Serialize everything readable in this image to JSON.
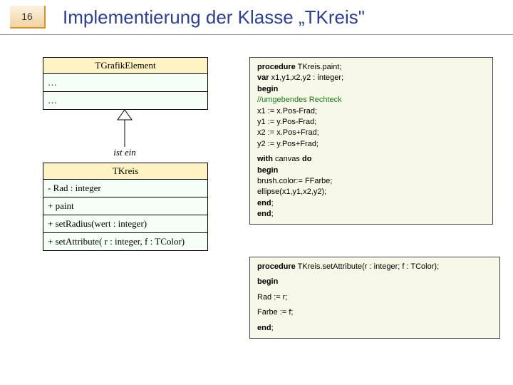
{
  "slide_number": "16",
  "title": "Implementierung der Klasse „TKreis\"",
  "uml": {
    "parent": {
      "name": "TGrafikElement",
      "row1": "…",
      "row2": "…"
    },
    "relation": "ist ein",
    "child": {
      "name": "TKreis",
      "attr1": "- Rad : integer",
      "op1": "+ paint",
      "op2": "+ setRadius(wert : integer)",
      "op3": "+ setAttribute( r : integer, f : TColor)"
    }
  },
  "code1": {
    "l1a": "procedure",
    "l1b": " TKreis.paint;",
    "l2a": "var",
    "l2b": "  x1,y1,x2,y2 : integer;",
    "l3": "begin",
    "l4": "  //umgebendes Rechteck",
    "l5": "  x1 := x.Pos-Frad;",
    "l6": "  y1 := y.Pos-Frad;",
    "l7": "  x2 := x.Pos+Frad;",
    "l8": "  y2 := y.Pos+Frad;",
    "l9a": "  with",
    "l9b": " canvas ",
    "l9c": "do",
    "l10": "   begin",
    "l11": "    brush.color:= FFarbe;",
    "l12": "    ellipse(x1,y1,x2,y2);",
    "l13": "   end",
    "l14": "end",
    "semi": ";"
  },
  "code2": {
    "l1a": "procedure",
    "l1b": " TKreis.setAttribute(r : integer; f : TColor);",
    "l2": "begin",
    "l3": "  Rad := r;",
    "l4": "  Farbe := f;",
    "l5": "end",
    "semi": ";"
  }
}
